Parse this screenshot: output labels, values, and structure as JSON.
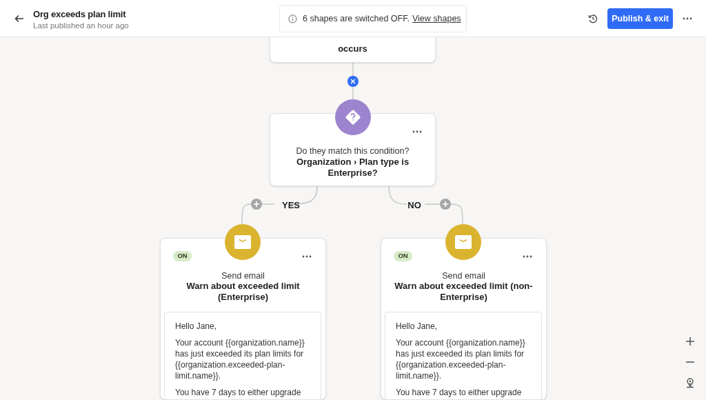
{
  "header": {
    "title": "Org exceeds plan limit",
    "subtitle": "Last published an hour ago",
    "notice": {
      "text": "6 shapes are switched OFF.",
      "link": "View shapes"
    },
    "publish_button": "Publish & exit"
  },
  "trigger": {
    "text_tail": "occurs"
  },
  "condition": {
    "prompt": "Do they match this condition?",
    "rule": "Organization › Plan type is Enterprise?"
  },
  "branches": [
    {
      "label": "YES",
      "action": {
        "status": "ON",
        "on": true,
        "type": "Send email",
        "title": "Warn about exceeded limit (Enterprise)",
        "body": [
          "Hello Jane,",
          "Your account {{organization.name}} has just exceeded its plan limits for {{organization.exceeded-plan-limit.name}}.",
          "You have 7 days to either upgrade"
        ]
      }
    },
    {
      "label": "NO",
      "action": {
        "status": "ON",
        "on": true,
        "type": "Send email",
        "title": "Warn about exceeded limit (non-Enterprise)",
        "body": [
          "Hello Jane,",
          "Your account {{organization.name}} has just exceeded its plan limits for {{organization.exceeded-plan-limit.name}}.",
          "You have 7 days to either upgrade"
        ]
      }
    }
  ]
}
